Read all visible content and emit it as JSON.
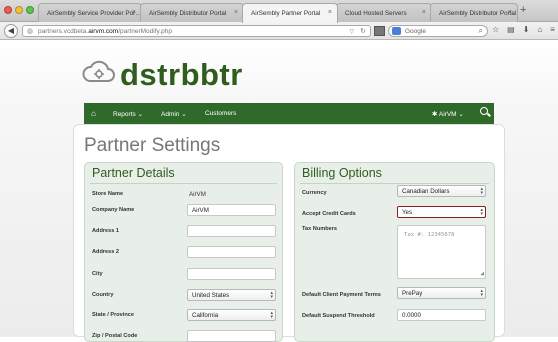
{
  "browser": {
    "tabs": [
      {
        "label": "AirSembly Service Provider Por…",
        "active": false
      },
      {
        "label": "AirSembly Distributor Portal",
        "active": false
      },
      {
        "label": "AirSembly Partner Portal",
        "active": true
      },
      {
        "label": "Cloud Hosted Servers",
        "active": false
      },
      {
        "label": "AirSembly Distributor Portal",
        "active": false
      }
    ],
    "new_tab": "+",
    "url_prefix": "partners.vcdbeta.",
    "url_host": "airvm.com",
    "url_path": "/partnerModify.php",
    "search_placeholder": "Google"
  },
  "logo": {
    "text": "dstrbbtr"
  },
  "nav": {
    "reports": "Reports",
    "admin": "Admin",
    "customers": "Customers",
    "user": "AirVM"
  },
  "page": {
    "title": "Partner Settings"
  },
  "partner": {
    "heading": "Partner Details",
    "store_label": "Store Name",
    "store_value": "AirVM",
    "company_label": "Company Name",
    "company_value": "AirVM",
    "address1_label": "Address 1",
    "address1_value": "",
    "address2_label": "Address 2",
    "address2_value": "",
    "city_label": "City",
    "city_value": "",
    "country_label": "Country",
    "country_value": "United States",
    "state_label": "State / Province",
    "state_value": "California",
    "zip_label": "Zip / Postal Code"
  },
  "billing": {
    "heading": "Billing Options",
    "currency_label": "Currency",
    "currency_value": "Canadian Dollars",
    "credit_label": "Accept Credit Cards",
    "credit_value": "Yes",
    "tax_label": "Tax Numbers",
    "tax_placeholder": "Tax #: 12345678",
    "payment_label": "Default Client Payment Terms",
    "payment_value": "PrePay",
    "suspend_label": "Default Suspend Threshold",
    "suspend_value": "0.0000"
  },
  "colors": {
    "brand": "#2f5d1e",
    "nav": "#2f6a2b",
    "panel": "#e8efe8"
  }
}
